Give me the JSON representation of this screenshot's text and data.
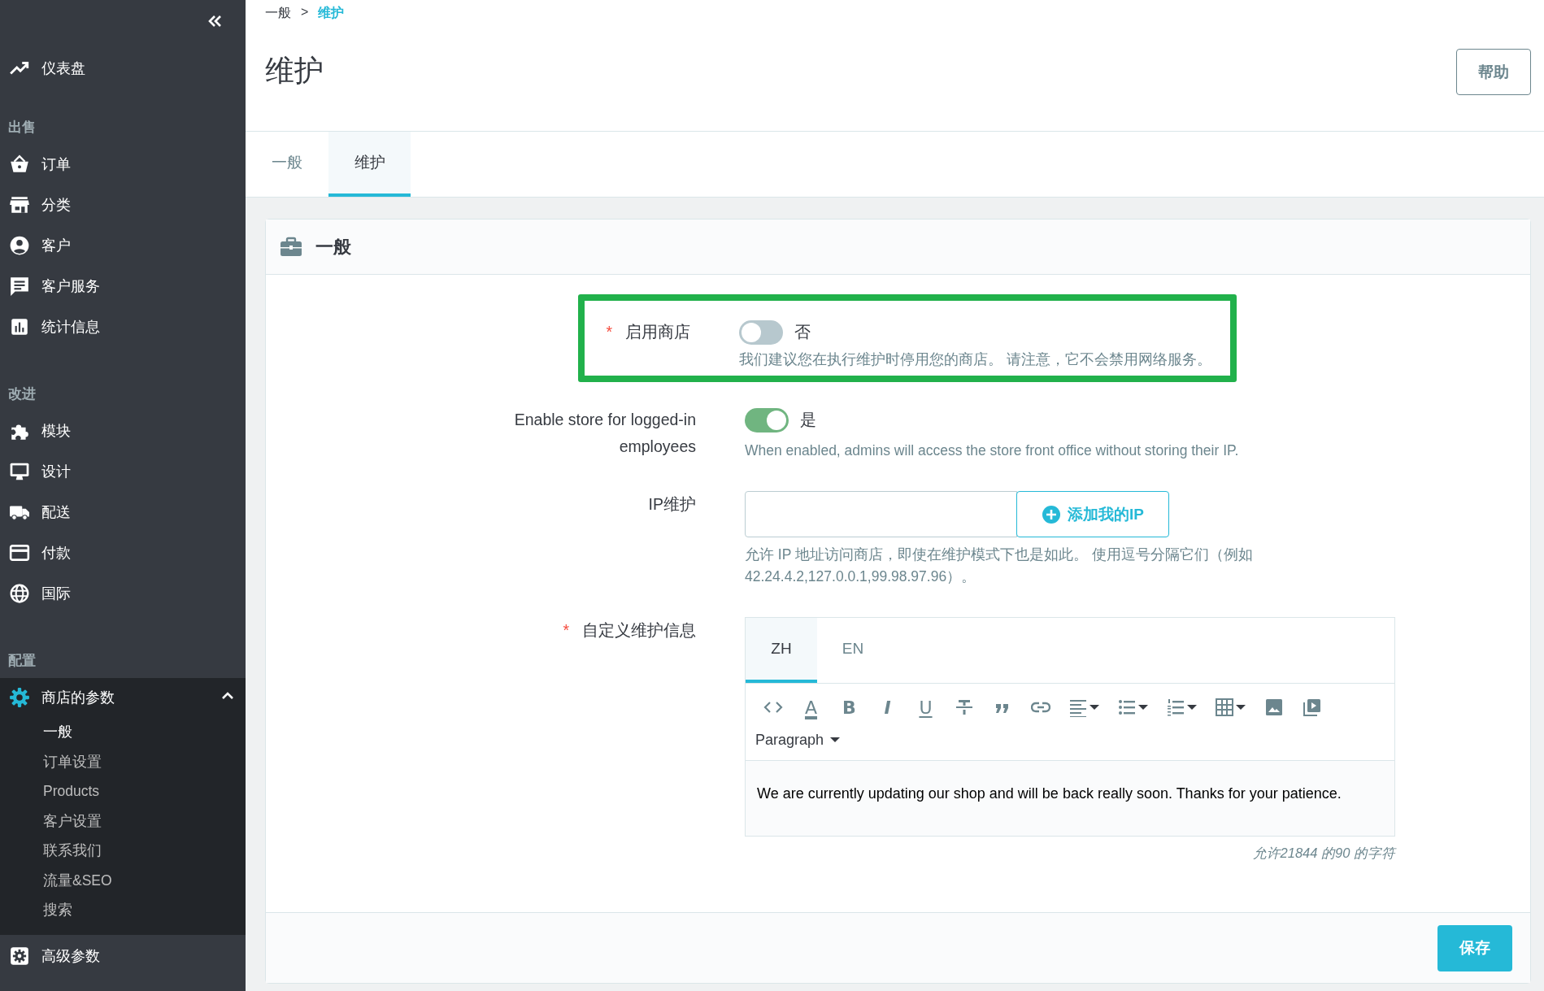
{
  "sidebar": {
    "dashboard": {
      "label": "仪表盘"
    },
    "sections": [
      {
        "title": "出售",
        "items": [
          {
            "label": "订单",
            "selected": false
          },
          {
            "label": "分类",
            "selected": false
          },
          {
            "label": "客户",
            "selected": false
          },
          {
            "label": "客户服务",
            "selected": false
          },
          {
            "label": "统计信息",
            "selected": false
          }
        ]
      },
      {
        "title": "改进",
        "items": [
          {
            "label": "模块",
            "selected": false
          },
          {
            "label": "设计",
            "selected": false
          },
          {
            "label": "配送",
            "selected": false
          },
          {
            "label": "付款",
            "selected": false
          },
          {
            "label": "国际",
            "selected": false
          }
        ]
      },
      {
        "title": "配置",
        "items": [
          {
            "label": "商店的参数",
            "selected": true,
            "expanded": true,
            "children": [
              {
                "label": "一般",
                "selected": true
              },
              {
                "label": "订单设置",
                "selected": false
              },
              {
                "label": "Products",
                "selected": false
              },
              {
                "label": "客户设置",
                "selected": false
              },
              {
                "label": "联系我们",
                "selected": false
              },
              {
                "label": "流量&SEO",
                "selected": false
              },
              {
                "label": "搜索",
                "selected": false
              }
            ]
          },
          {
            "label": "高级参数",
            "selected": false
          }
        ]
      }
    ]
  },
  "breadcrumb": {
    "separator": ">",
    "items": [
      {
        "label": "一般",
        "current": false
      },
      {
        "label": "维护",
        "current": true
      }
    ]
  },
  "page_title": "维护",
  "help_button": "帮助",
  "tabs": [
    {
      "label": "一般",
      "selected": false
    },
    {
      "label": "维护",
      "selected": true
    }
  ],
  "card": {
    "title": "一般",
    "fields": [
      {
        "kind": "toggle",
        "label": "启用商店",
        "required_mark": "*",
        "highlighted": true,
        "on": false,
        "value_text": "否",
        "help": "我们建议您在执行维护时停用您的商店。 请注意，它不会禁用网络服务。"
      },
      {
        "kind": "toggle",
        "label": "Enable store for logged-in employees",
        "on": true,
        "value_text": "是",
        "help": "When enabled, admins will access the store front office without storing their IP."
      },
      {
        "kind": "ip",
        "label": "IP维护",
        "button": "添加我的IP",
        "help": "允许 IP 地址访问商店，即使在维护模式下也是如此。 使用逗号分隔它们（例如 42.24.4.2,127.0.0.1,99.98.97.96）。"
      },
      {
        "kind": "editor",
        "label": "自定义维护信息",
        "required_mark": "*",
        "languages": [
          {
            "label": "ZH",
            "selected": true
          },
          {
            "label": "EN",
            "selected": false
          }
        ],
        "toolbar": [
          {
            "kind": "code"
          },
          {
            "kind": "color",
            "text": "A"
          },
          {
            "kind": "bold",
            "text": "B"
          },
          {
            "kind": "italic",
            "text": "I"
          },
          {
            "kind": "underline",
            "text": "U"
          },
          {
            "kind": "strike"
          },
          {
            "kind": "quote"
          },
          {
            "kind": "link"
          },
          {
            "kind": "align",
            "dropdown": true
          },
          {
            "kind": "bullets",
            "dropdown": true
          },
          {
            "kind": "numbers",
            "dropdown": true
          },
          {
            "kind": "table",
            "dropdown": true
          },
          {
            "kind": "image"
          },
          {
            "kind": "video"
          }
        ],
        "format": "Paragraph",
        "content": "We are currently updating our shop and will be back really soon. Thanks for your patience.",
        "counter": "允许21844 的90 的字符"
      }
    ],
    "save_button": "保存"
  }
}
